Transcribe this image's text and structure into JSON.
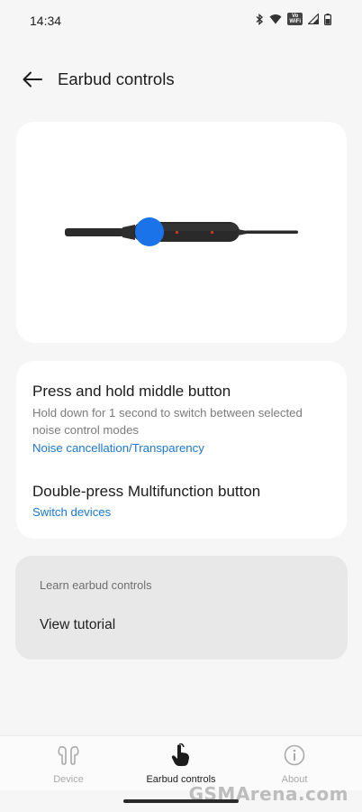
{
  "status_bar": {
    "time": "14:34",
    "icons": [
      "bluetooth-icon",
      "wifi-icon",
      "vowifi-icon",
      "signal-icon",
      "battery-icon"
    ],
    "vowifi_top": "Vo",
    "vowifi_bottom": "WiFi"
  },
  "header": {
    "back_icon": "arrow-left-icon",
    "title": "Earbud controls"
  },
  "illustration": {
    "description_icon": "earbud-remote-illustration",
    "highlight_color": "#1a73e8"
  },
  "controls": [
    {
      "title": "Press and hold middle button",
      "description": "Hold down for 1 second to switch between selected noise control modes",
      "action": "Noise cancellation/Transparency"
    },
    {
      "title": "Double-press Multifunction button",
      "action": "Switch devices"
    }
  ],
  "learn": {
    "header": "Learn earbud controls",
    "item": "View tutorial"
  },
  "bottom_nav": [
    {
      "label": "Device",
      "icon": "earbuds-icon",
      "active": false
    },
    {
      "label": "Earbud controls",
      "icon": "touch-icon",
      "active": true
    },
    {
      "label": "About",
      "icon": "info-icon",
      "active": false
    }
  ],
  "watermark": "GSMArena.com",
  "colors": {
    "accent": "#1a78d2",
    "background": "#f6f6f6",
    "card": "#ffffff"
  }
}
